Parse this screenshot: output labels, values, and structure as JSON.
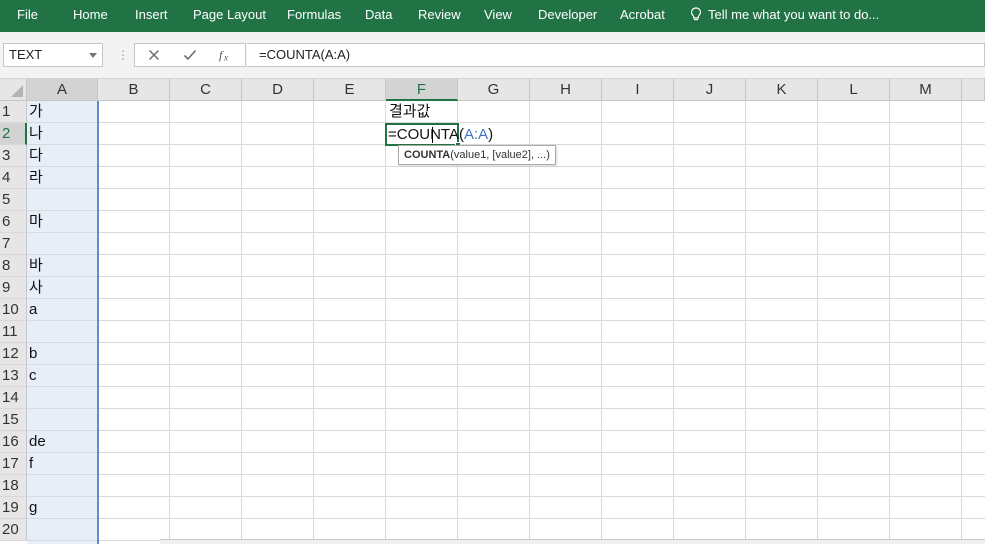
{
  "ribbon": {
    "tabs": [
      "File",
      "Home",
      "Insert",
      "Page Layout",
      "Formulas",
      "Data",
      "Review",
      "View",
      "Developer",
      "Acrobat"
    ],
    "tell_me": "Tell me what you want to do...",
    "icon": "lightbulb-icon",
    "color": "#217346"
  },
  "formula_bar": {
    "name_box": "TEXT",
    "formula": "=COUNTA(A:A)",
    "icons": [
      "cancel-icon",
      "enter-icon",
      "function-icon"
    ]
  },
  "grid": {
    "columns": [
      "A",
      "B",
      "C",
      "D",
      "E",
      "F",
      "G",
      "H",
      "I",
      "J",
      "K",
      "L",
      "M"
    ],
    "rows": [
      "1",
      "2",
      "3",
      "4",
      "5",
      "6",
      "7",
      "8",
      "9",
      "10",
      "11",
      "12",
      "13",
      "14",
      "15",
      "16",
      "17",
      "18",
      "19",
      "20"
    ],
    "column_a": [
      "가",
      "나",
      "다",
      "라",
      "",
      "마",
      "",
      "바",
      "사",
      "a",
      "",
      "b",
      "c",
      "",
      "",
      "de",
      "f",
      "",
      "g",
      ""
    ],
    "f1": "결과값",
    "active_cell": {
      "prefix": "=COUNTA(",
      "reference": "A:A",
      "suffix": ")"
    },
    "tooltip": {
      "function": "COUNTA",
      "args": "(value1, [value2], ...)"
    },
    "selected_column_color": "#e7eef8",
    "accent": "#217346"
  }
}
